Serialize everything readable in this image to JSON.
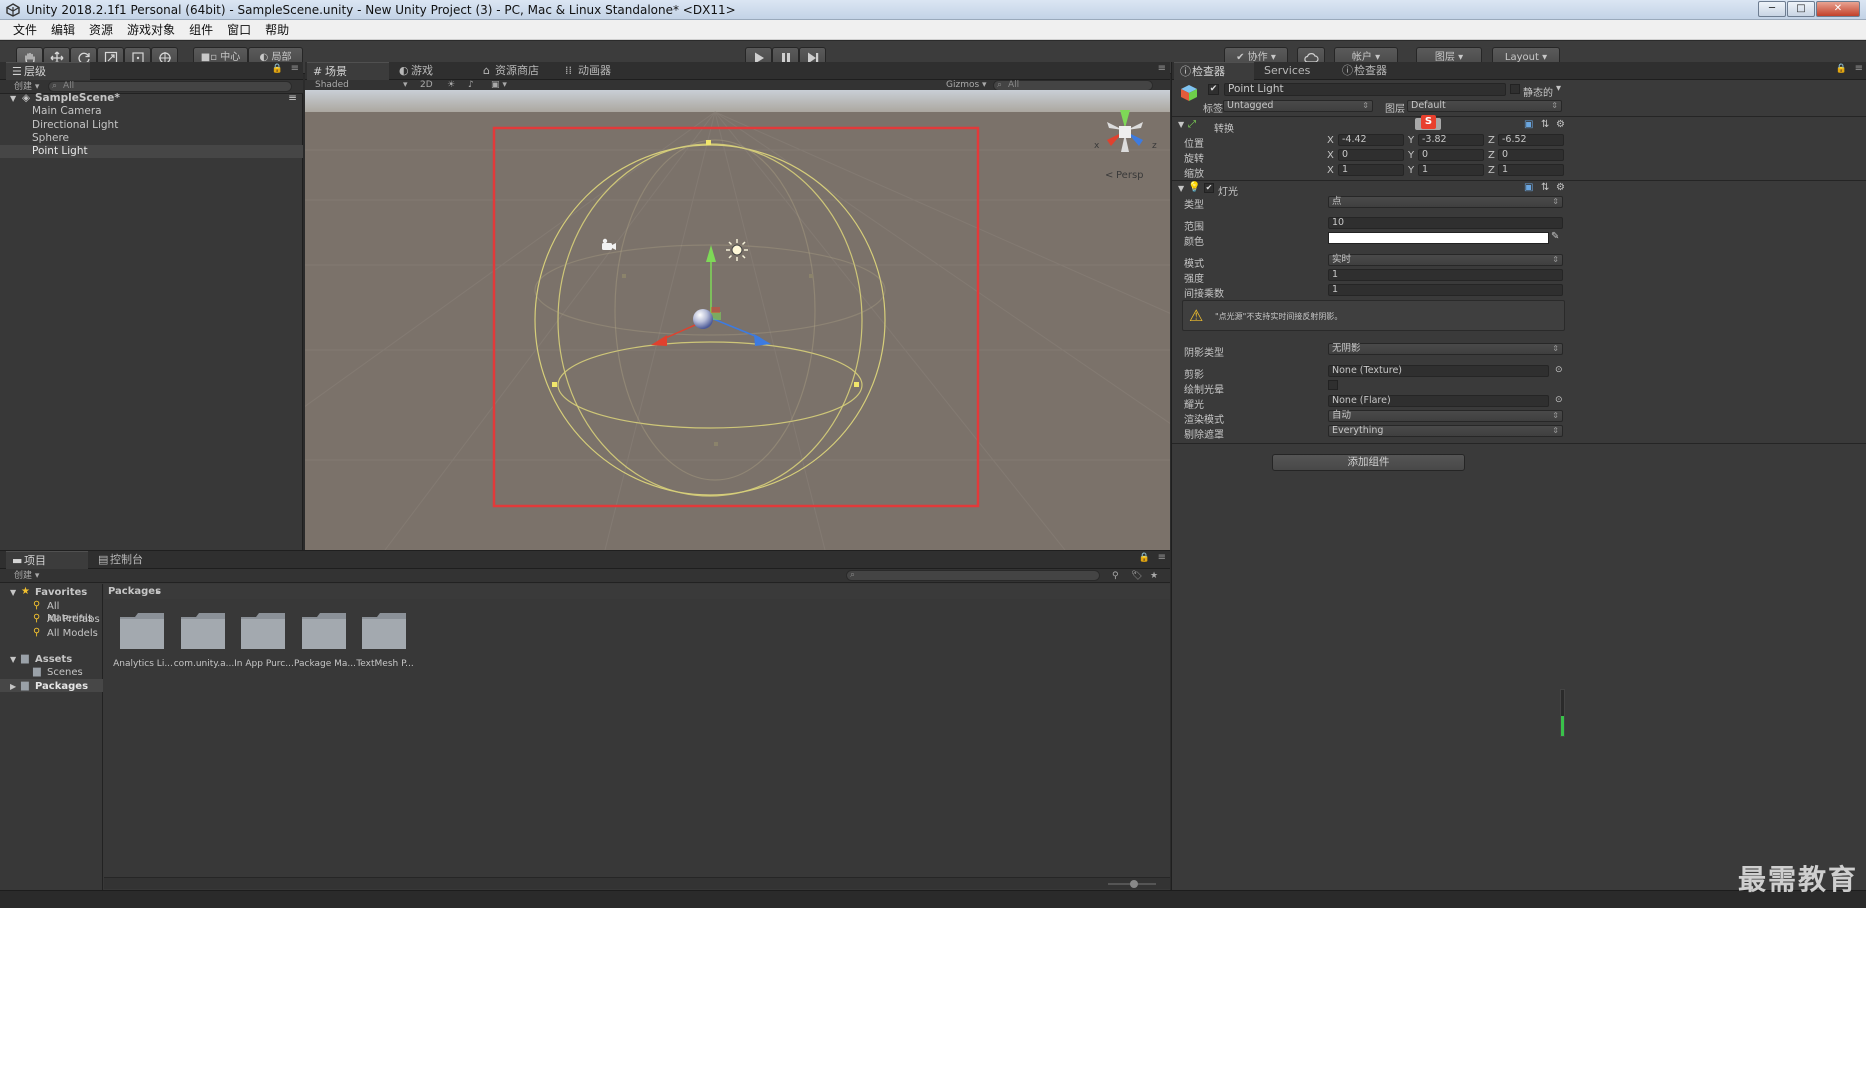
{
  "window": {
    "title": "Unity 2018.2.1f1 Personal (64bit) - SampleScene.unity - New Unity Project (3) - PC, Mac & Linux Standalone* <DX11>",
    "controls": [
      "─",
      "□",
      "✕"
    ]
  },
  "menu": [
    "文件",
    "编辑",
    "资源",
    "游戏对象",
    "组件",
    "窗口",
    "帮助"
  ],
  "toolbar": {
    "pivot_label": "中心",
    "space_label": "局部",
    "collab_label": "协作",
    "account_label": "帐户",
    "layers_label": "图层",
    "layout_label": "Layout"
  },
  "hierarchy": {
    "tab": "层级",
    "create": "创建",
    "search_placeholder": "All",
    "scene": "SampleScene*",
    "items": [
      "Main Camera",
      "Directional Light",
      "Sphere",
      "Point Light"
    ]
  },
  "scene_panel": {
    "tabs": [
      "场景",
      "游戏",
      "资源商店",
      "动画器"
    ],
    "shading": "Shaded",
    "mode_2d": "2D",
    "gizmos": "Gizmos",
    "search_placeholder": "All",
    "persp": "Persp",
    "axis_x": "x",
    "axis_z": "z"
  },
  "inspector": {
    "tabs": [
      "检查器",
      "Services",
      "检查器"
    ],
    "object_name": "Point Light",
    "static_label": "静态的",
    "tag_label": "标签",
    "tag_value": "Untagged",
    "layer_label": "图层",
    "layer_value": "Default",
    "transform": {
      "title": "转换",
      "position_label": "位置",
      "rotation_label": "旋转",
      "scale_label": "缩放",
      "position": {
        "x": "-4.42",
        "y": "-3.82",
        "z": "-6.52"
      },
      "rotation": {
        "x": "0",
        "y": "0",
        "z": "0"
      },
      "scale": {
        "x": "1",
        "y": "1",
        "z": "1"
      }
    },
    "light": {
      "title": "灯光",
      "type_label": "类型",
      "type_value": "点",
      "range_label": "范围",
      "range_value": "10",
      "color_label": "颜色",
      "mode_label": "模式",
      "mode_value": "实时",
      "intensity_label": "强度",
      "intensity_value": "1",
      "indirect_label": "间接乘数",
      "indirect_value": "1",
      "warning": "\"点光源\"不支持实时间接反射阴影。",
      "shadow_type_label": "阴影类型",
      "shadow_type_value": "无阴影",
      "cookie_label": "剪影",
      "cookie_value": "None (Texture)",
      "halo_label": "绘制光晕",
      "flare_label": "耀光",
      "flare_value": "None (Flare)",
      "render_mode_label": "渲染模式",
      "render_mode_value": "自动",
      "culling_label": "剔除遮罩",
      "culling_value": "Everything"
    },
    "add_component": "添加组件"
  },
  "project": {
    "tabs": [
      "项目",
      "控制台"
    ],
    "create": "创建",
    "favorites": "Favorites",
    "fav_items": [
      "All Materials",
      "All Prefabs",
      "All Models"
    ],
    "assets": "Assets",
    "scenes": "Scenes",
    "packages": "Packages",
    "breadcrumb": "Packages",
    "folders": [
      "Analytics Li...",
      "com.unity.a...",
      "In App Purc...",
      "Package Ma...",
      "TextMesh P..."
    ]
  },
  "watermark": "最需教育",
  "colors": {
    "highlight_rect": "#e23a3a",
    "gizmo_wire": "#d7cf7a",
    "axis_y": "#7ed957",
    "axis_x": "#e0412e",
    "axis_z": "#3d7be0"
  }
}
